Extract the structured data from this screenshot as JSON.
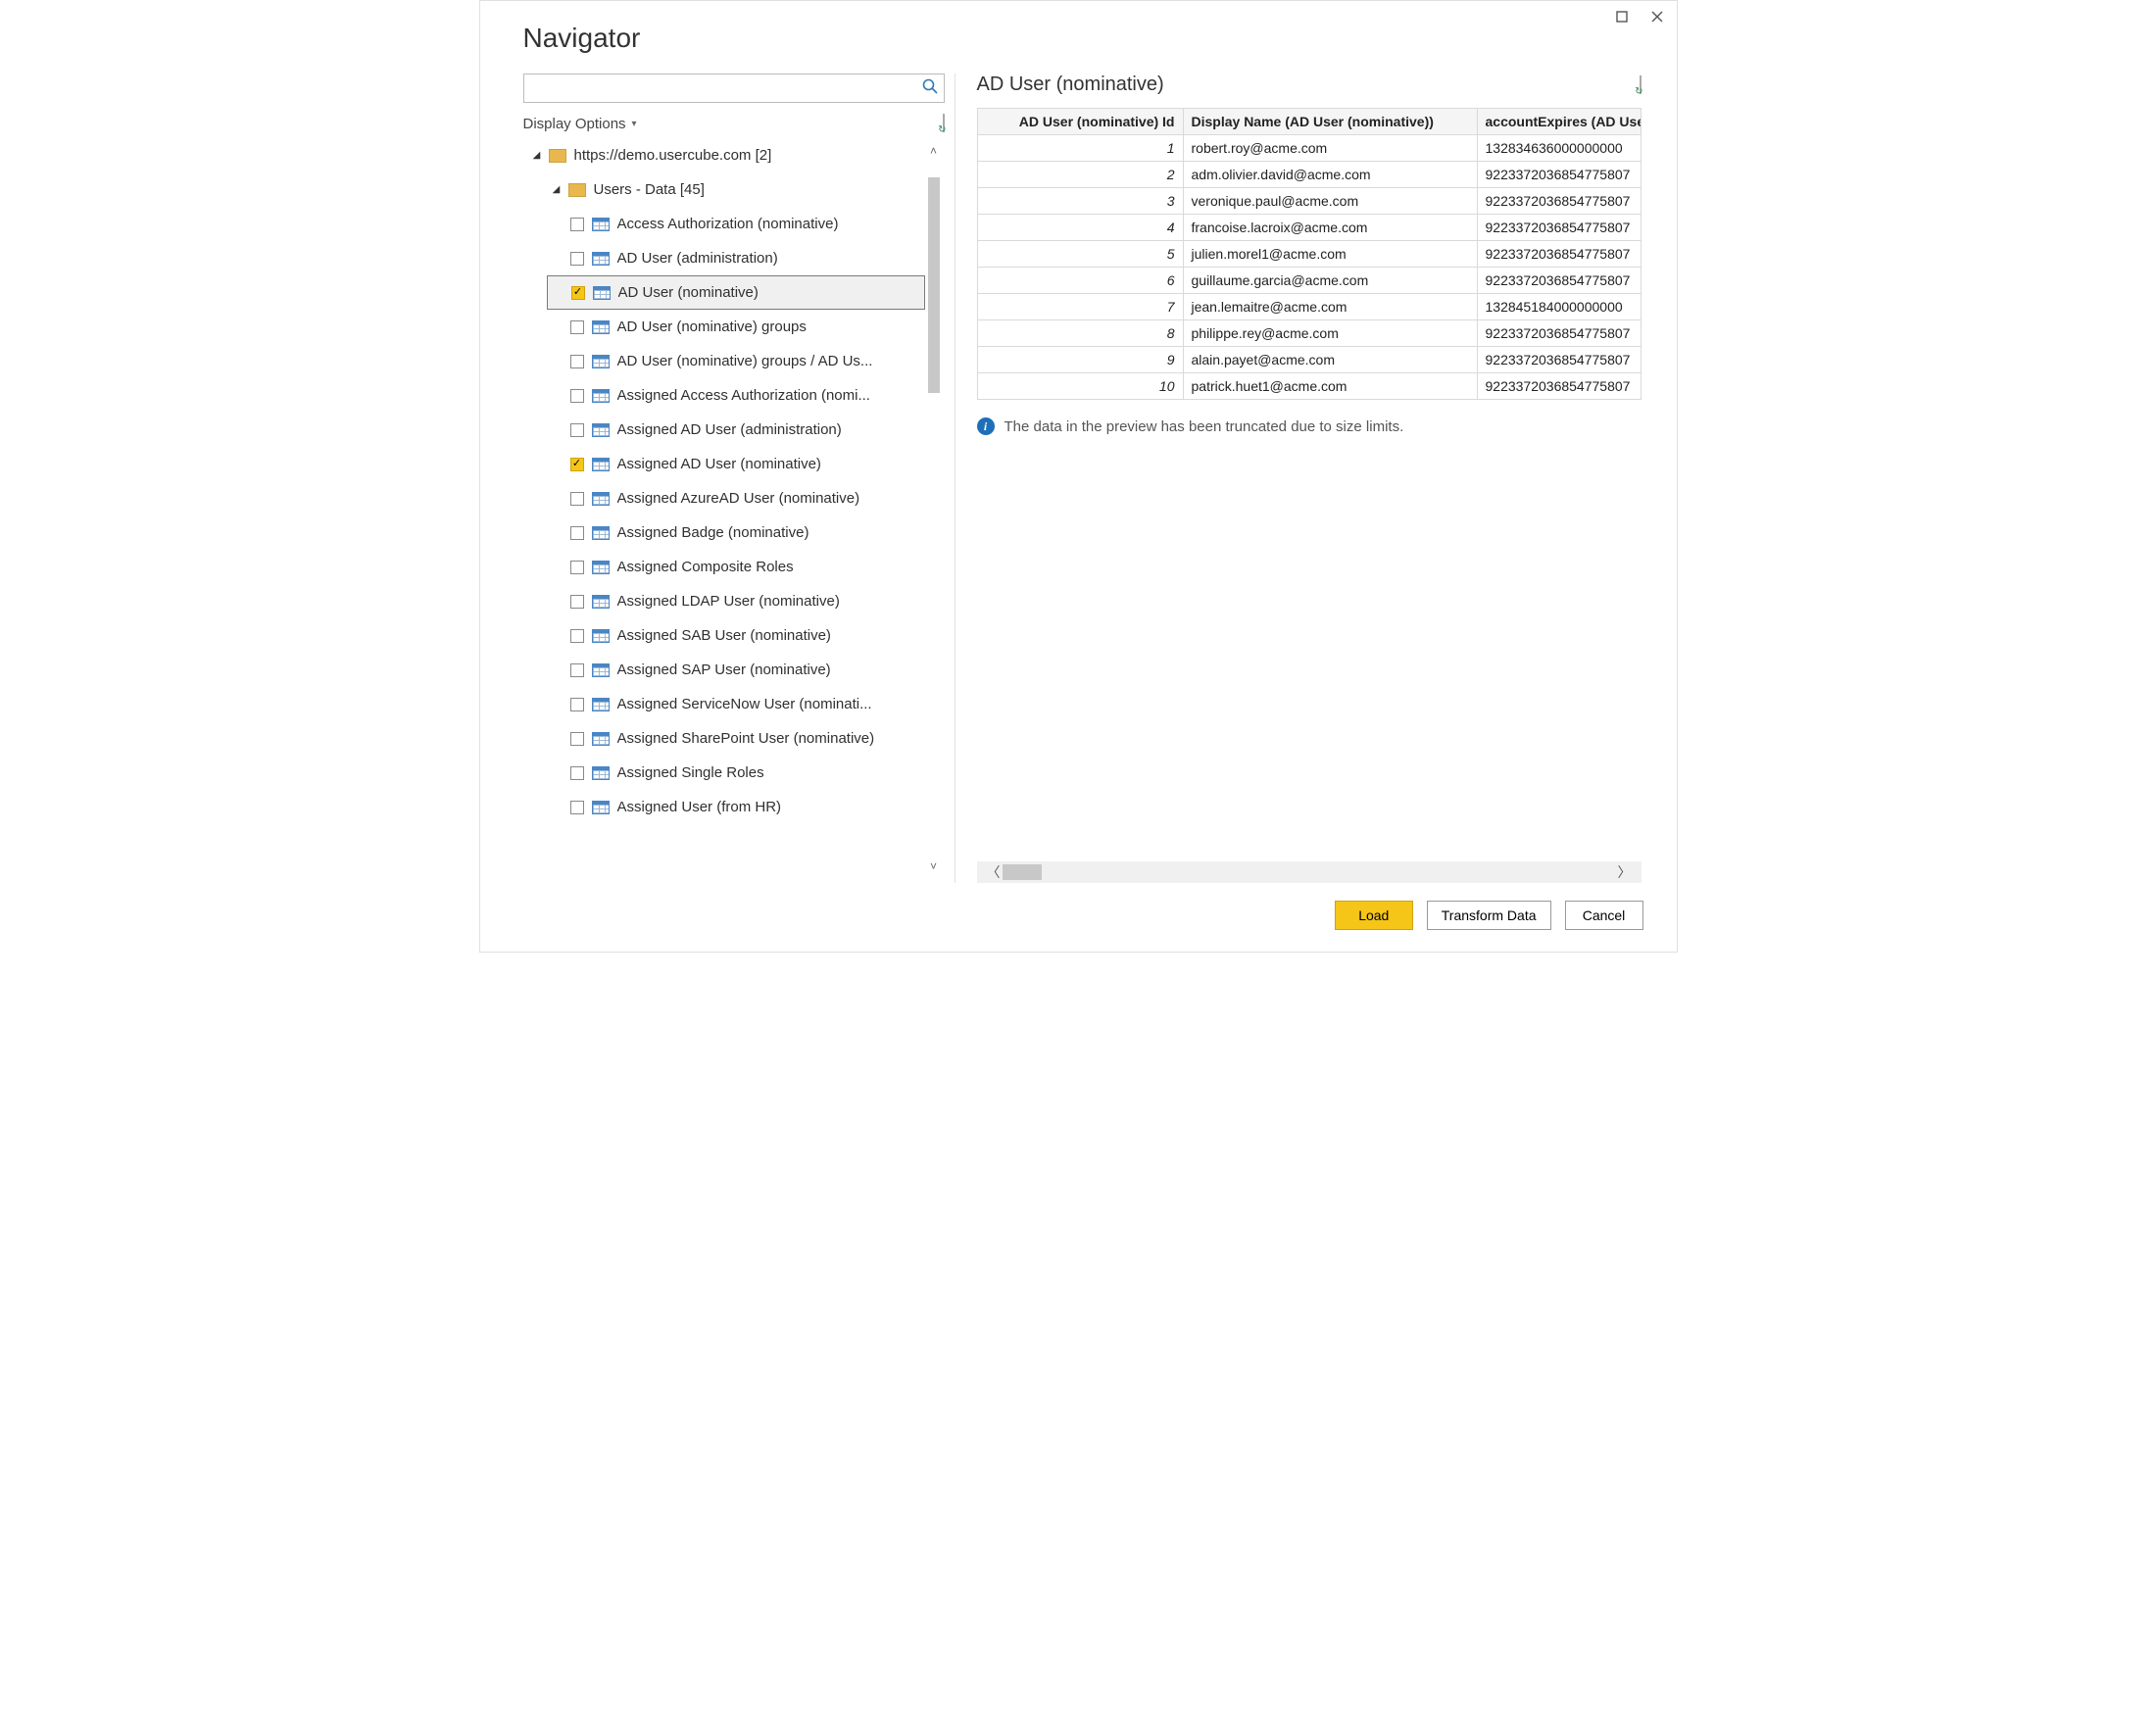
{
  "window": {
    "title": "Navigator"
  },
  "search": {
    "placeholder": ""
  },
  "displayOptions": {
    "label": "Display Options"
  },
  "tree": {
    "root": {
      "label": "https://demo.usercube.com [2]"
    },
    "group": {
      "label": "Users - Data [45]"
    },
    "items": [
      {
        "label": "Access Authorization (nominative)",
        "checked": false
      },
      {
        "label": "AD User (administration)",
        "checked": false
      },
      {
        "label": "AD User (nominative)",
        "checked": true,
        "selected": true
      },
      {
        "label": "AD User (nominative) groups",
        "checked": false
      },
      {
        "label": "AD User (nominative) groups / AD Us...",
        "checked": false
      },
      {
        "label": "Assigned Access Authorization (nomi...",
        "checked": false
      },
      {
        "label": "Assigned AD User (administration)",
        "checked": false
      },
      {
        "label": "Assigned AD User (nominative)",
        "checked": true
      },
      {
        "label": "Assigned AzureAD User (nominative)",
        "checked": false
      },
      {
        "label": "Assigned Badge (nominative)",
        "checked": false
      },
      {
        "label": "Assigned Composite Roles",
        "checked": false
      },
      {
        "label": "Assigned LDAP User (nominative)",
        "checked": false
      },
      {
        "label": "Assigned SAB User (nominative)",
        "checked": false
      },
      {
        "label": "Assigned SAP User (nominative)",
        "checked": false
      },
      {
        "label": "Assigned ServiceNow User (nominati...",
        "checked": false
      },
      {
        "label": "Assigned SharePoint User (nominative)",
        "checked": false
      },
      {
        "label": "Assigned Single Roles",
        "checked": false
      },
      {
        "label": "Assigned User (from HR)",
        "checked": false
      }
    ]
  },
  "preview": {
    "title": "AD User (nominative)",
    "columns": [
      "AD User (nominative) Id",
      "Display Name (AD User (nominative))",
      "accountExpires (AD Use"
    ],
    "rows": [
      {
        "id": "1",
        "name": "robert.roy@acme.com",
        "exp": "132834636000000000"
      },
      {
        "id": "2",
        "name": "adm.olivier.david@acme.com",
        "exp": "9223372036854775807"
      },
      {
        "id": "3",
        "name": "veronique.paul@acme.com",
        "exp": "9223372036854775807"
      },
      {
        "id": "4",
        "name": "francoise.lacroix@acme.com",
        "exp": "9223372036854775807"
      },
      {
        "id": "5",
        "name": "julien.morel1@acme.com",
        "exp": "9223372036854775807"
      },
      {
        "id": "6",
        "name": "guillaume.garcia@acme.com",
        "exp": "9223372036854775807"
      },
      {
        "id": "7",
        "name": "jean.lemaitre@acme.com",
        "exp": "132845184000000000"
      },
      {
        "id": "8",
        "name": "philippe.rey@acme.com",
        "exp": "9223372036854775807"
      },
      {
        "id": "9",
        "name": "alain.payet@acme.com",
        "exp": "9223372036854775807"
      },
      {
        "id": "10",
        "name": "patrick.huet1@acme.com",
        "exp": "9223372036854775807"
      }
    ],
    "truncated_note": "The data in the preview has been truncated due to size limits."
  },
  "footer": {
    "load": "Load",
    "transform": "Transform Data",
    "cancel": "Cancel"
  }
}
